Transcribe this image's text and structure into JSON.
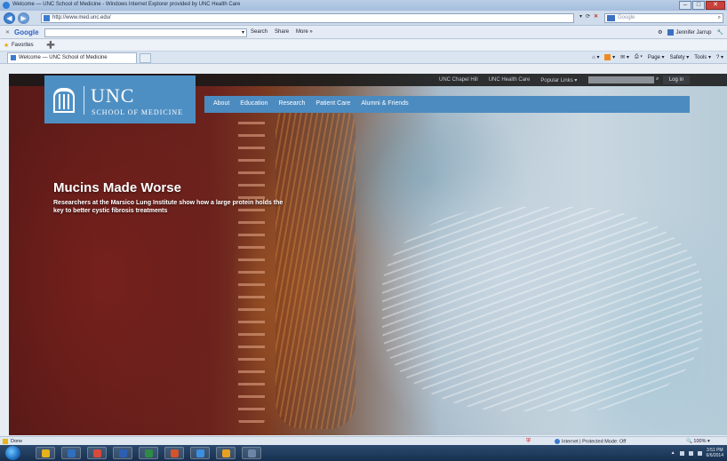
{
  "browser": {
    "window_title": "Welcome — UNC School of Medicine - Windows Internet Explorer provided by UNC Health Care",
    "address": "http://www.med.unc.edu/",
    "search_engine_placeholder": "Google",
    "google_toolbar": {
      "logo": "Google",
      "search_btn": "Search",
      "share_btn": "Share",
      "more_btn": "More »",
      "user": "Jennifer Jarrup"
    },
    "favorites_label": "Favorites",
    "tab_title": "Welcome — UNC School of Medicine",
    "commands": {
      "page": "Page",
      "safety": "Safety",
      "tools": "Tools"
    },
    "status": {
      "left": "Done",
      "zone": "Internet | Protected Mode: Off",
      "zoom": "100%"
    }
  },
  "site": {
    "top_links": [
      "UNC Chapel Hill",
      "UNC Health Care",
      "Popular Links ▾"
    ],
    "login": "Log in",
    "logo": {
      "name": "UNC",
      "subtitle": "SCHOOL OF MEDICINE"
    },
    "nav": [
      "About",
      "Education",
      "Research",
      "Patient Care",
      "Alumni & Friends"
    ],
    "feature": {
      "headline": "Mucins Made Worse",
      "subhead": "Researchers at the Marsico Lung Institute show how a large protein holds the key to better cystic fibrosis treatments"
    }
  },
  "taskbar": {
    "clock_time": "3:51 PM",
    "clock_date": "6/6/2014",
    "apps": [
      {
        "name": "explorer",
        "color": "#e8b21a"
      },
      {
        "name": "media",
        "color": "#2f6fc0"
      },
      {
        "name": "chrome",
        "color": "#d94a3a"
      },
      {
        "name": "word",
        "color": "#2b5fb3"
      },
      {
        "name": "excel",
        "color": "#2e8b46"
      },
      {
        "name": "powerpoint",
        "color": "#d4532b"
      },
      {
        "name": "ie",
        "color": "#3a8fe0"
      },
      {
        "name": "outlook",
        "color": "#e8a020"
      },
      {
        "name": "other",
        "color": "#6d86a8"
      }
    ]
  }
}
